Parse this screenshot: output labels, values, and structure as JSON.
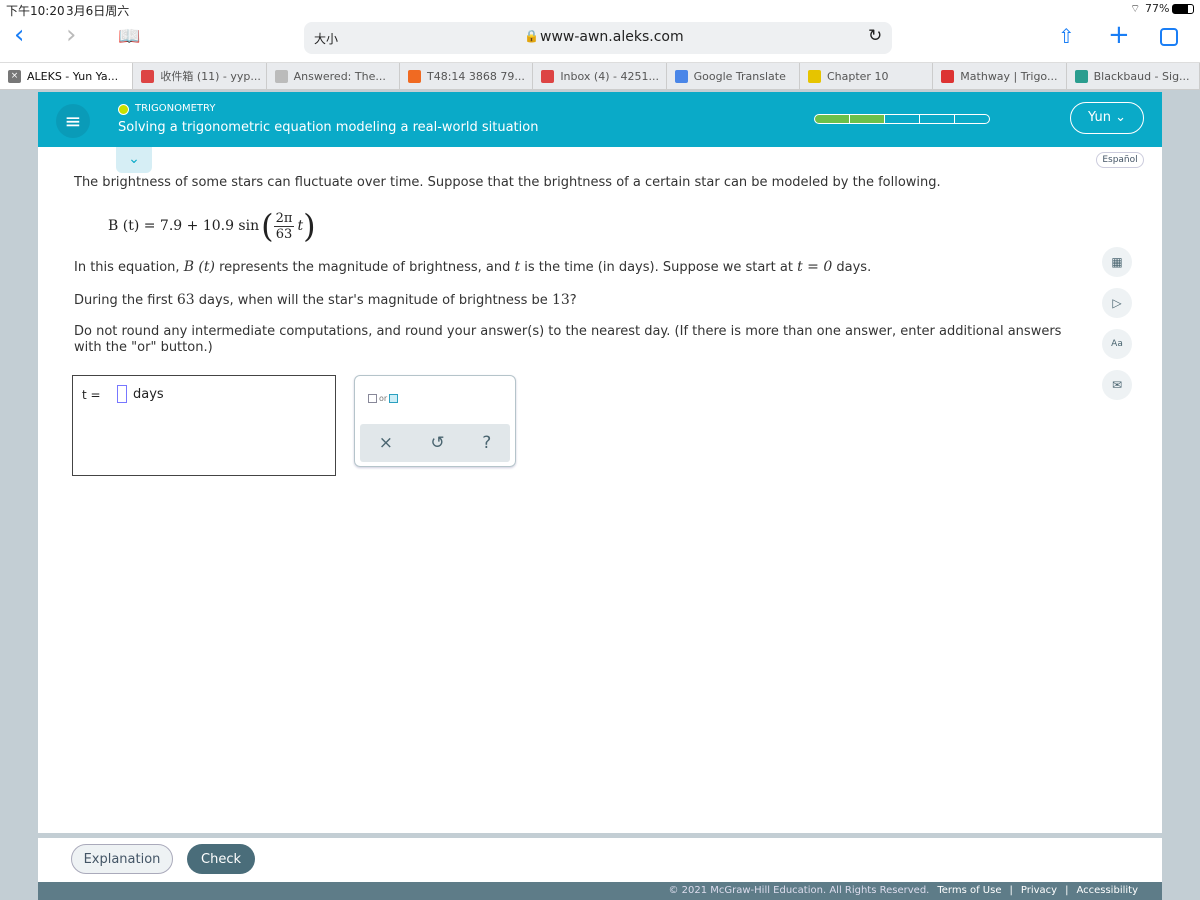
{
  "status": {
    "time": "下午10:20",
    "date": "3月6日周六",
    "battery": "77%"
  },
  "browser": {
    "text_size": "大小",
    "url": "www-awn.aleks.com"
  },
  "tabs": [
    {
      "label": "ALEKS - Yun Ya...",
      "icon": "close-icon",
      "color": "#777"
    },
    {
      "label": "收件箱 (11) - yyp...",
      "icon": "gmail-icon",
      "color": "#d44"
    },
    {
      "label": "Answered: The...",
      "icon": "bartleby-icon",
      "color": "#bbb"
    },
    {
      "label": "T48:14 3868 79...",
      "icon": "chegg-icon",
      "color": "#f06a22"
    },
    {
      "label": "Inbox (4) - 4251...",
      "icon": "gmail-icon",
      "color": "#d44"
    },
    {
      "label": "Google Translate",
      "icon": "translate-icon",
      "color": "#4a86e8"
    },
    {
      "label": "Chapter 10",
      "icon": "chapter-icon",
      "color": "#e6c400"
    },
    {
      "label": "Mathway | Trigo...",
      "icon": "mathway-icon",
      "color": "#d33"
    },
    {
      "label": "Blackbaud - Sig...",
      "icon": "blackbaud-icon",
      "color": "#2a9d8f"
    }
  ],
  "header": {
    "topic": "TRIGONOMETRY",
    "title": "Solving a trigonometric equation modeling a real-world situation",
    "progress_filled": 2,
    "progress_total": 5,
    "user": "Yun",
    "accent": "#0aaac8"
  },
  "language": "Español",
  "question": {
    "intro": "The brightness of some stars can fluctuate over time. Suppose that the brightness of a certain star can be modeled by the following.",
    "eq_lhs": "B (t) = 7.9 + 10.9 sin",
    "eq_num": "2π",
    "eq_den": "63",
    "eq_var": "t",
    "p2a": "In this equation, ",
    "p2b": "B (t)",
    "p2c": " represents the magnitude of brightness, and ",
    "p2d": "t",
    "p2e": " is the time (in days). Suppose we start at ",
    "p2f": "t = 0",
    "p2g": " days.",
    "p3a": "During the first ",
    "p3b": "63",
    "p3c": " days, when will the star's magnitude of brightness be ",
    "p3d": "13",
    "p3e": "?",
    "p4": "Do not round any intermediate computations, and round your answer(s) to the nearest day. (If there is more than one answer, enter additional answers with the \"or\" button.)"
  },
  "answer": {
    "prefix": "t =",
    "value": "",
    "unit": "days"
  },
  "tools": {
    "or": "or",
    "clear": "×",
    "undo": "↺",
    "help": "?"
  },
  "buttons": {
    "explanation": "Explanation",
    "check": "Check"
  },
  "footer": {
    "copyright": "© 2021 McGraw-Hill Education. All Rights Reserved.",
    "terms": "Terms of Use",
    "privacy": "Privacy",
    "accessibility": "Accessibility"
  }
}
